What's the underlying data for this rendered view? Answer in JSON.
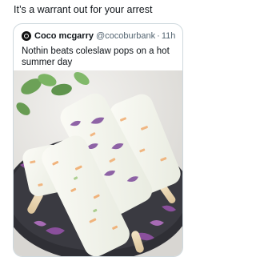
{
  "caption": "It’s a warrant out for your arrest",
  "quoted_tweet": {
    "display_name": "Coco mcgarry",
    "handle": "@cocoburbank",
    "separator": "·",
    "time": "11h",
    "text": "Nothin beats coleslaw pops on a hot summer day"
  },
  "image": {
    "subject": "coleslaw popsicles on a plate"
  },
  "colors": {
    "border": "#cfd9de",
    "secondary_text": "#536471",
    "primary_text": "#0f1419"
  }
}
